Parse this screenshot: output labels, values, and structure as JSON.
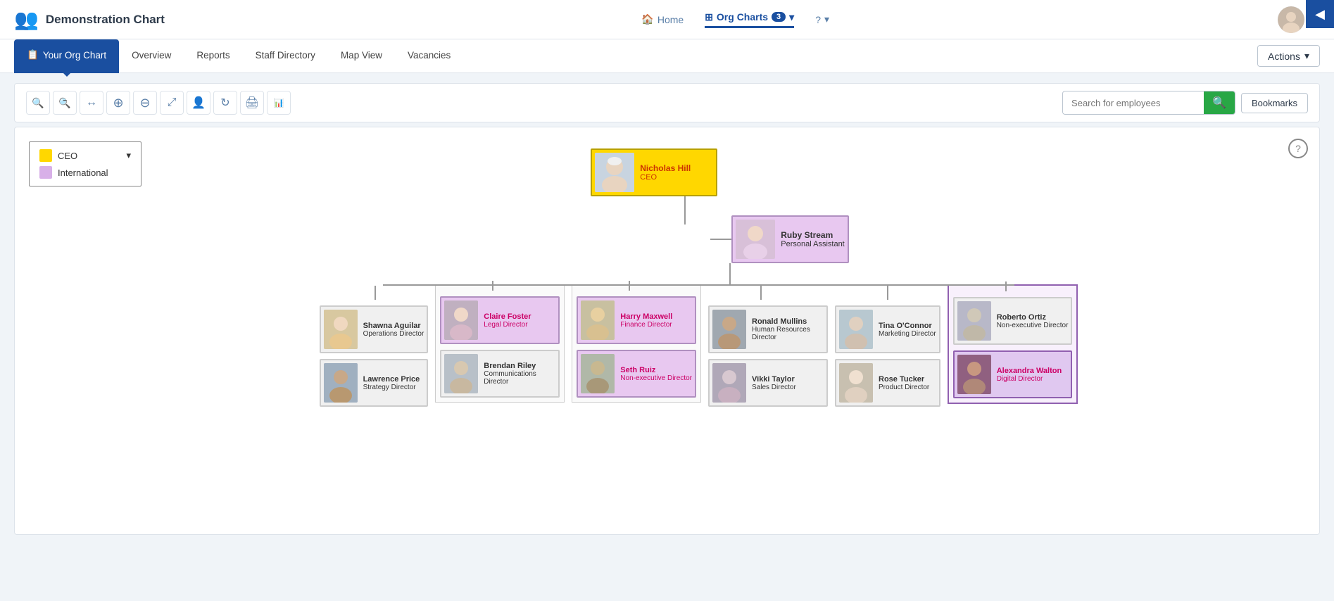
{
  "app": {
    "brand": {
      "title": "Demonstration Chart",
      "icon": "👥"
    }
  },
  "top_nav": {
    "home_label": "Home",
    "org_charts_label": "Org Charts",
    "org_charts_badge": "3",
    "help_label": "?",
    "avatar_caret": "▾",
    "corner_icon": "◀"
  },
  "sub_nav": {
    "tabs": [
      {
        "id": "your-org-chart",
        "label": "Your Org Chart",
        "active": true
      },
      {
        "id": "overview",
        "label": "Overview",
        "active": false
      },
      {
        "id": "reports",
        "label": "Reports",
        "active": false
      },
      {
        "id": "staff-directory",
        "label": "Staff Directory",
        "active": false
      },
      {
        "id": "map-view",
        "label": "Map View",
        "active": false
      },
      {
        "id": "vacancies",
        "label": "Vacancies",
        "active": false
      }
    ],
    "actions_label": "Actions",
    "actions_caret": "▾"
  },
  "toolbar": {
    "tools": [
      {
        "id": "zoom-in",
        "icon": "🔍",
        "label": "Zoom In",
        "symbol": "+"
      },
      {
        "id": "zoom-out",
        "icon": "🔍",
        "label": "Zoom Out",
        "symbol": "−"
      },
      {
        "id": "fit",
        "icon": "↔",
        "label": "Fit to Screen"
      },
      {
        "id": "expand",
        "icon": "⊕",
        "label": "Expand All"
      },
      {
        "id": "collapse",
        "icon": "⊖",
        "label": "Collapse All"
      },
      {
        "id": "fullscreen",
        "icon": "⤢",
        "label": "Fullscreen"
      },
      {
        "id": "person",
        "icon": "👤",
        "label": "Person"
      },
      {
        "id": "refresh",
        "icon": "↻",
        "label": "Refresh"
      },
      {
        "id": "print",
        "icon": "🖨",
        "label": "Print"
      },
      {
        "id": "export",
        "icon": "📊",
        "label": "Export"
      }
    ],
    "search_placeholder": "Search for employees",
    "search_btn_label": "🔍",
    "bookmarks_label": "Bookmarks"
  },
  "legend": {
    "items": [
      {
        "id": "ceo",
        "color": "#ffd700",
        "label": "CEO",
        "has_caret": true
      },
      {
        "id": "international",
        "color": "#d8b0e8",
        "label": "International",
        "has_caret": false
      }
    ]
  },
  "chart": {
    "root": {
      "name": "Nicholas Hill",
      "role": "CEO",
      "photo_class": "photo-ceo",
      "style": "ceo"
    },
    "pa": {
      "name": "Ruby Stream",
      "role": "Personal Assistant",
      "photo_class": "photo-pa",
      "style": "pa"
    },
    "columns": [
      {
        "id": "col1",
        "nodes": [
          {
            "name": "Shawna Aguilar",
            "role": "Operations Director",
            "photo_class": "photo-1",
            "style": "grey"
          },
          {
            "name": "Lawrence Price",
            "role": "Strategy Director",
            "photo_class": "photo-2",
            "style": "grey"
          }
        ]
      },
      {
        "id": "col2",
        "nodes": [
          {
            "name": "Claire Foster",
            "role": "Legal Director",
            "photo_class": "photo-3",
            "style": "purple"
          },
          {
            "name": "Brendan Riley",
            "role": "Communications Director",
            "photo_class": "photo-4",
            "style": "grey"
          }
        ]
      },
      {
        "id": "col3",
        "nodes": [
          {
            "name": "Harry Maxwell",
            "role": "Finance Director",
            "photo_class": "photo-5",
            "style": "purple"
          },
          {
            "name": "Seth Ruiz",
            "role": "Non-executive Director",
            "photo_class": "photo-6",
            "style": "purple"
          }
        ]
      },
      {
        "id": "col4",
        "nodes": [
          {
            "name": "Ronald Mullins",
            "role": "Human Resources Director",
            "photo_class": "photo-7",
            "style": "grey"
          },
          {
            "name": "Vikki Taylor",
            "role": "Sales Director",
            "photo_class": "photo-8",
            "style": "grey"
          }
        ]
      },
      {
        "id": "col5",
        "nodes": [
          {
            "name": "Tina O'Connor",
            "role": "Marketing Director",
            "photo_class": "photo-9",
            "style": "grey"
          },
          {
            "name": "Rose Tucker",
            "role": "Product Director",
            "photo_class": "photo-10",
            "style": "grey"
          }
        ]
      },
      {
        "id": "col6",
        "nodes": [
          {
            "name": "Roberto Ortiz",
            "role": "Non-executive Director",
            "photo_class": "photo-11",
            "style": "grey"
          },
          {
            "name": "Alexandra Walton",
            "role": "Digital Director",
            "photo_class": "photo-12",
            "style": "highlight-purple"
          }
        ]
      }
    ]
  },
  "help": {
    "label": "?"
  }
}
